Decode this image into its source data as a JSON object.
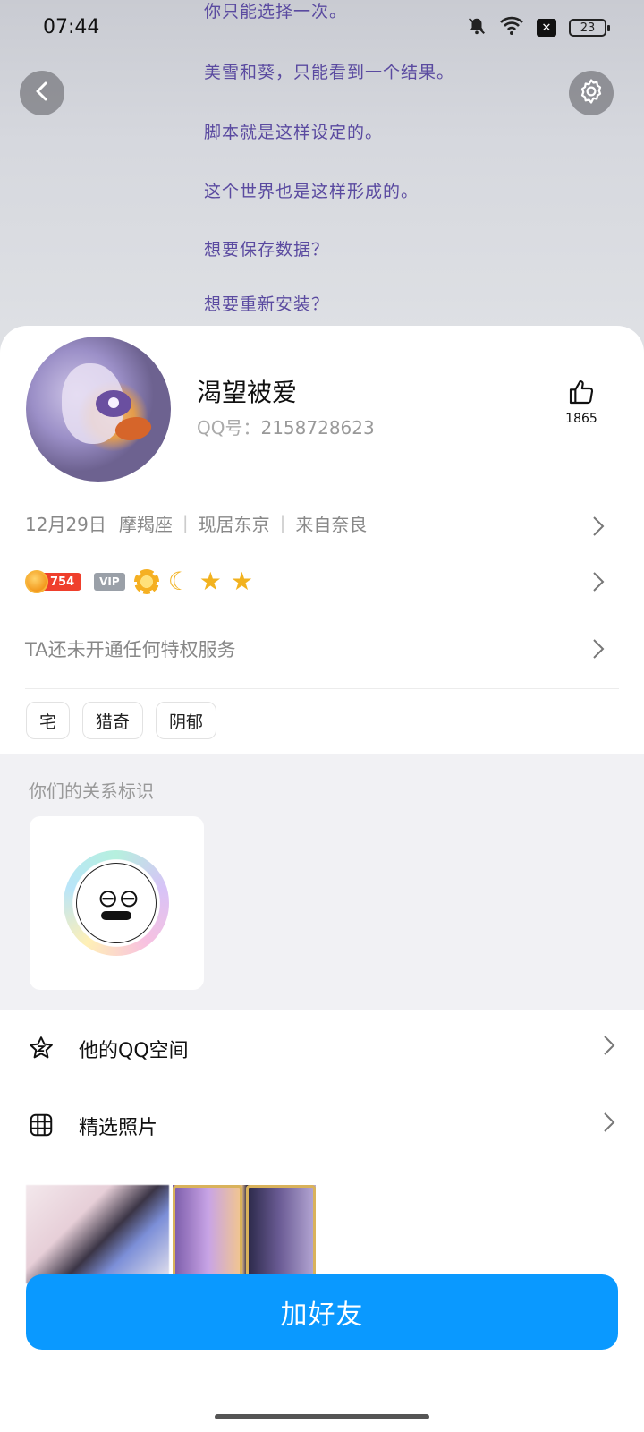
{
  "status_bar": {
    "time": "07:44",
    "battery": "23"
  },
  "banner": {
    "lines": [
      "你只能选择一次。",
      "美雪和葵，只能看到一个结果。",
      "脚本就是这样设定的。",
      "这个世界也是这样形成的。",
      "想要保存数据？",
      "想要重新安装？"
    ]
  },
  "profile": {
    "nickname": "渴望被爱",
    "qq_label": "QQ号：",
    "qq_number": "2158728623",
    "likes": "1865"
  },
  "info": {
    "birthday": "12月29日",
    "zodiac": "摩羯座",
    "residence": "现居东京",
    "hometown": "来自奈良"
  },
  "badges": {
    "level": "754",
    "vip": "VIP"
  },
  "privilege": "TA还未开通任何特权服务",
  "tags": [
    "宅",
    "猎奇",
    "阴郁"
  ],
  "relation": {
    "title": "你们的关系标识"
  },
  "menu": {
    "qzone": "他的QQ空间",
    "photos": "精选照片"
  },
  "action": {
    "add_friend": "加好友"
  },
  "colors": {
    "accent": "#0a99ff",
    "level_badge": "#ef3f2c",
    "vip_badge": "#9aa0a8",
    "banner_text": "#5a4aa0"
  }
}
